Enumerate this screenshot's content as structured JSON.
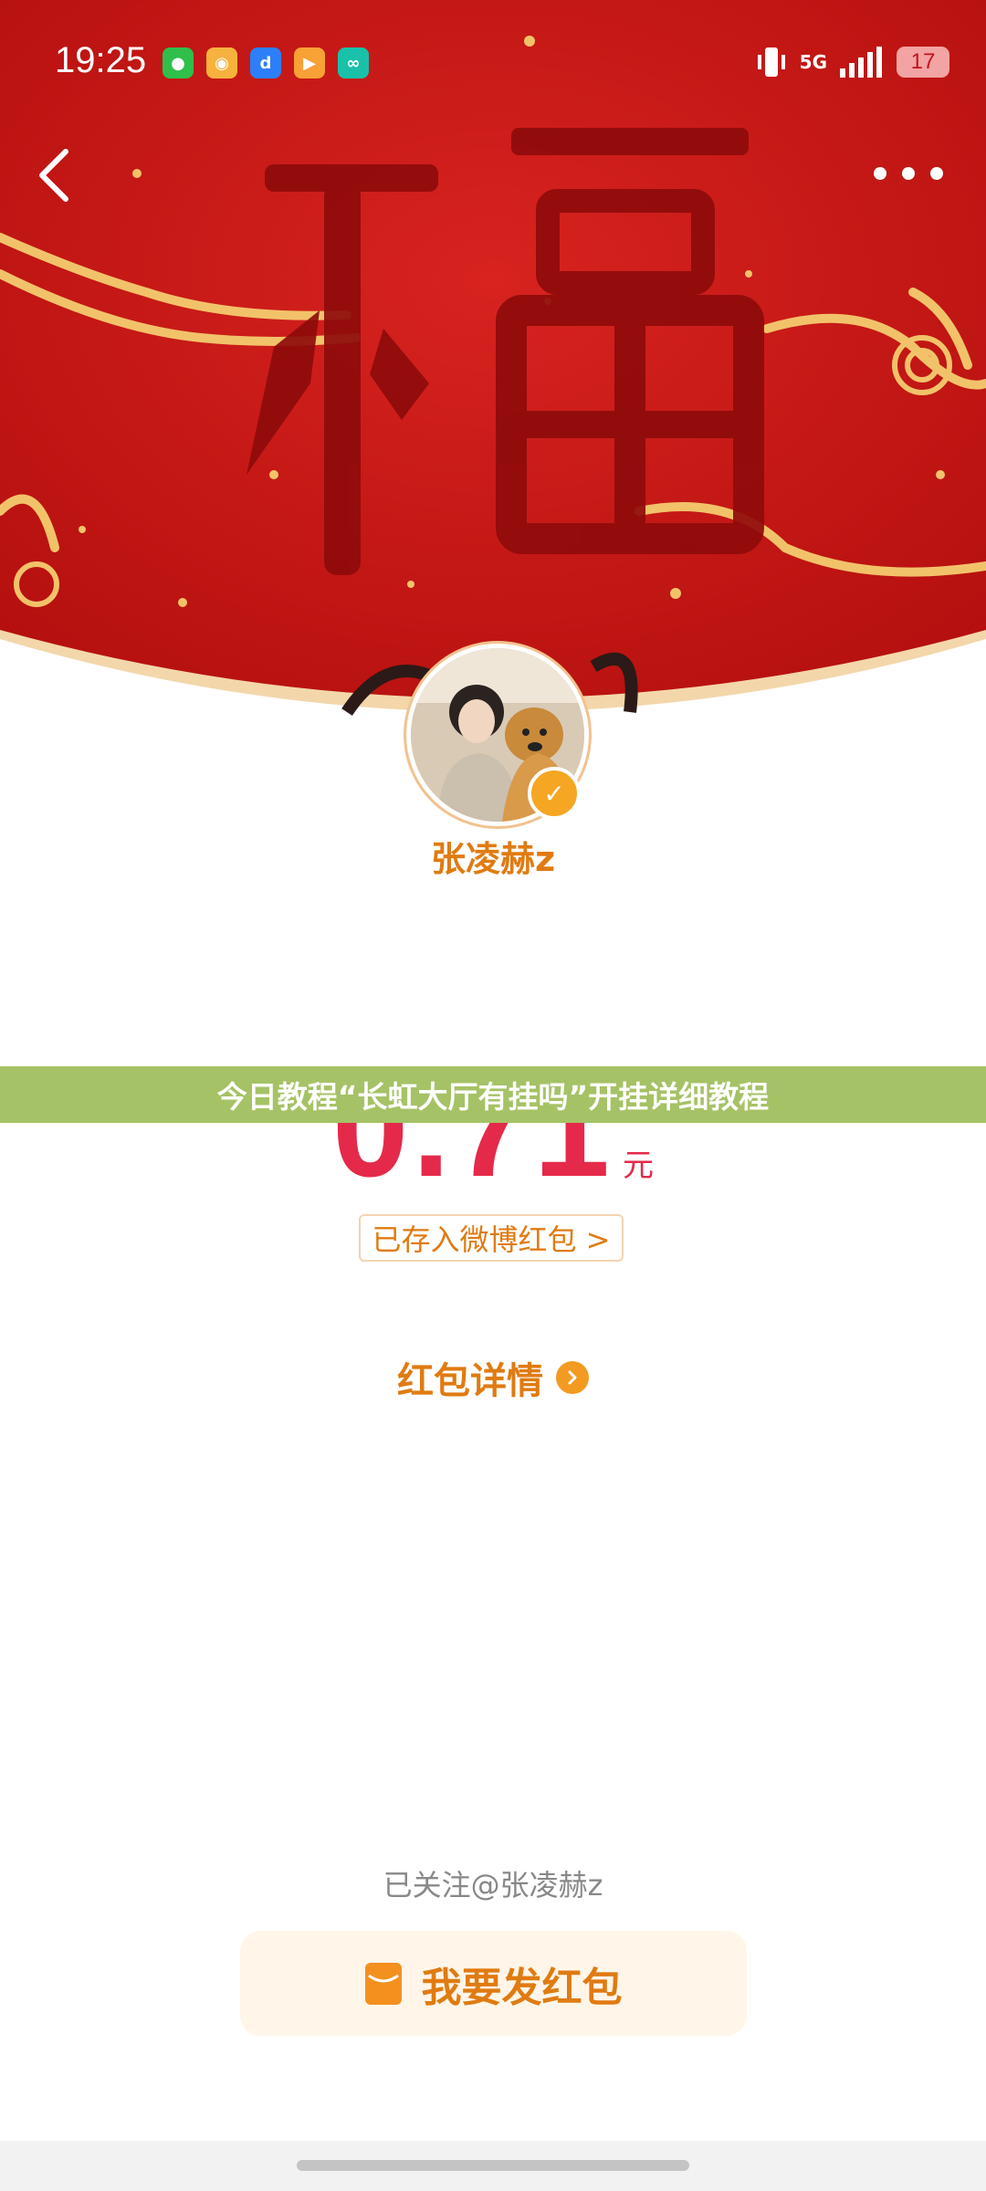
{
  "status_bar": {
    "time": "19:25",
    "network": "5G",
    "battery": "17",
    "app_icons": [
      "wechat-icon",
      "weibo-icon",
      "baidu-icon",
      "video-icon",
      "cloud-icon"
    ]
  },
  "header": {
    "calligraphy_char": "福",
    "colors": {
      "red": "#c8151b",
      "gold": "#f2c26a"
    }
  },
  "sender": {
    "name": "张凌赫z"
  },
  "banner": {
    "text": "今日教程“长虹大厅有挂吗”开挂详细教程",
    "color": "#a6c266"
  },
  "amount": {
    "value": "0.71",
    "unit": "元"
  },
  "links": {
    "saved": "已存入微博红包 >",
    "detail": "红包详情"
  },
  "footer": {
    "followed": "已关注@张凌赫z",
    "send_button": "我要发红包"
  }
}
